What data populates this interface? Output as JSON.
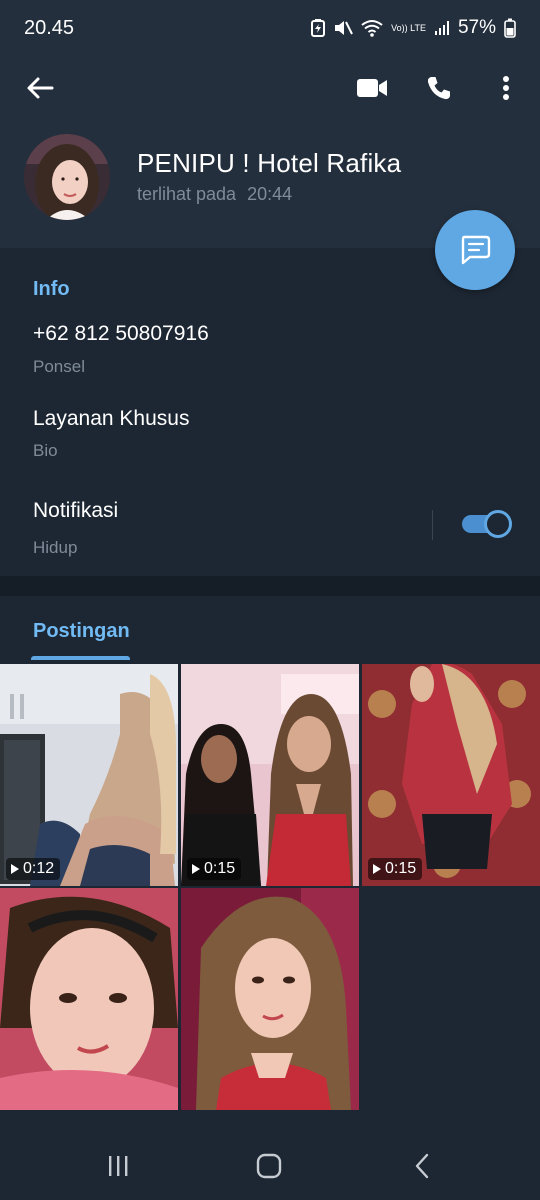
{
  "status_bar": {
    "time": "20.45",
    "battery": "57%",
    "network": "Vo)) LTE"
  },
  "header": {
    "back_icon": "arrow-left-icon",
    "video_icon": "video-camera-icon",
    "call_icon": "phone-icon",
    "menu_icon": "more-vertical-icon"
  },
  "profile": {
    "name": "PENIPU ! Hotel Rafika",
    "status_prefix": "terlihat pada",
    "status_time": "20:44"
  },
  "fab": {
    "icon": "message-icon"
  },
  "info": {
    "title": "Info",
    "phone": "+62 812 50807916",
    "phone_label": "Ponsel",
    "bio": "Layanan Khusus",
    "bio_label": "Bio",
    "notifications": "Notifikasi",
    "notifications_status": "Hidup",
    "notifications_enabled": true
  },
  "posts": {
    "tab_label": "Postingan",
    "items": [
      {
        "type": "video",
        "duration": "0:12"
      },
      {
        "type": "video",
        "duration": "0:15"
      },
      {
        "type": "video",
        "duration": "0:15"
      },
      {
        "type": "photo",
        "duration": ""
      },
      {
        "type": "photo",
        "duration": ""
      }
    ]
  },
  "nav": {
    "recents_icon": "recents-icon",
    "home_icon": "home-icon",
    "back_icon": "nav-back-icon"
  },
  "colors": {
    "accent": "#5fa8e4",
    "link": "#71baf4",
    "background": "#1d2733",
    "header": "#242f3d",
    "secondary_text": "#7f8b98"
  }
}
